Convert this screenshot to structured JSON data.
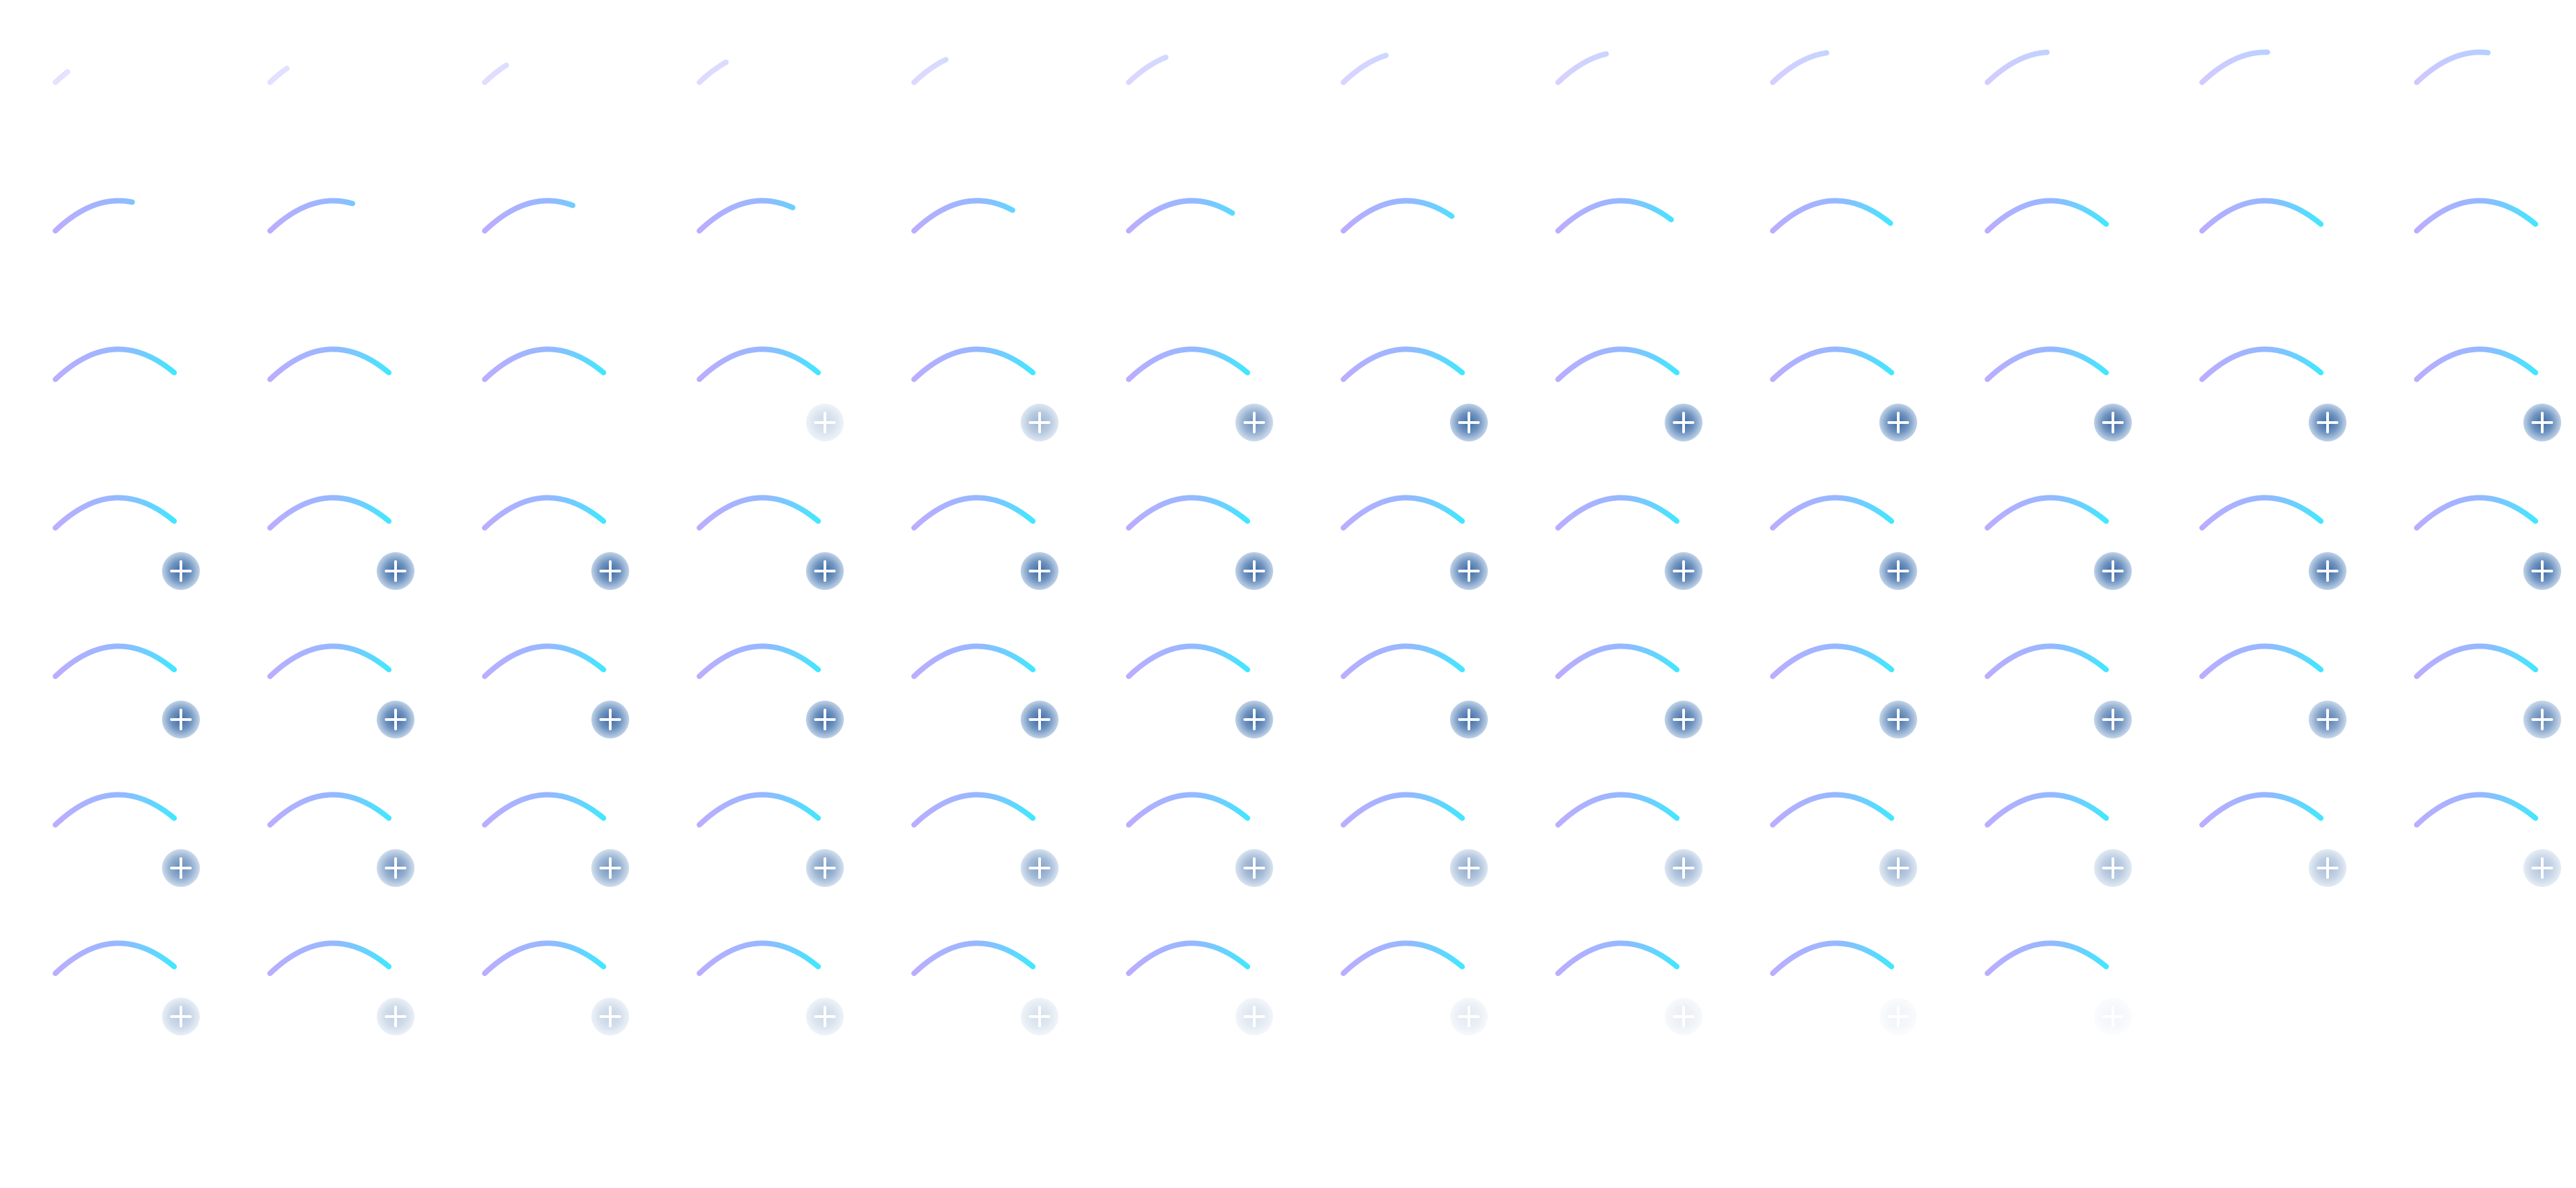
{
  "sprite_sheet": {
    "background": "#ffffff",
    "columns": 12,
    "rows": 7,
    "frame_count": 82,
    "arc_gradient": [
      "#b7a9ff",
      "#8fb4ff",
      "#38e6ff"
    ],
    "badge_color": "#4a76ad",
    "badge_icon": "plus-icon",
    "arc_icon": "arc-swoosh-icon"
  }
}
